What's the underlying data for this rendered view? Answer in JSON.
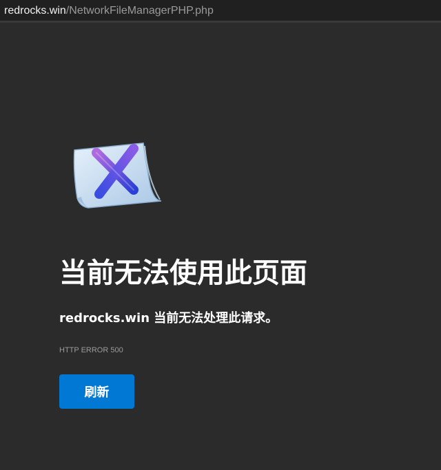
{
  "address_bar": {
    "host": "redrocks.win",
    "path": "/NetworkFileManagerPHP.php"
  },
  "error_page": {
    "icon": "document-error-x-icon",
    "title": "当前无法使用此页面",
    "message": "redrocks.win 当前无法处理此请求。",
    "error_code": "HTTP ERROR 500",
    "refresh_label": "刷新"
  },
  "colors": {
    "background": "#2b2b2b",
    "address_bar_bg": "#202020",
    "button_accent": "#0078d4",
    "muted_text": "#9c9c9c"
  }
}
